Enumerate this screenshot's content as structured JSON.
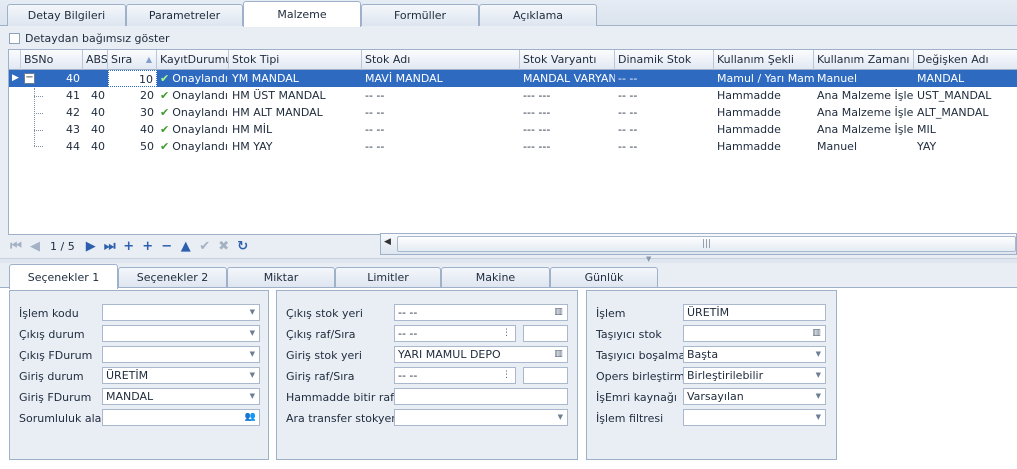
{
  "top_tabs": [
    "Detay Bilgileri",
    "Parametreler",
    "Malzeme",
    "Formüller",
    "Açıklama"
  ],
  "top_tab_active": "Malzeme",
  "independent_checkbox_label": "Detaydan bağımsız göster",
  "grid": {
    "columns": [
      "BSNo",
      "ABSI",
      "Sıra",
      "KayıtDurumu",
      "Stok Tipi",
      "Stok Adı",
      "Stok Varyantı",
      "Dinamik Stok",
      "Kullanım Şekli",
      "Kullanım Zamanı",
      "Değişken Adı"
    ],
    "rows": [
      {
        "bsno": "40",
        "absi": "",
        "sira": "10",
        "durum": "Onaylandı",
        "stok_tipi": "YM MANDAL",
        "stok_adi": "MAVİ MANDAL",
        "varyant": "MANDAL VARYANTI",
        "dinamik": "-- --",
        "kullanim_sekli": "Mamul / Yarı Mamul",
        "kullanim_zamani": "Manuel",
        "degisken": "MANDAL"
      },
      {
        "bsno": "41",
        "absi": "40",
        "sira": "20",
        "durum": "Onaylandı",
        "stok_tipi": "HM ÜST MANDAL",
        "stok_adi": "-- --",
        "varyant": "--- ---",
        "dinamik": "-- --",
        "kullanim_sekli": "Hammadde",
        "kullanim_zamani": "Ana Malzeme İşlemi",
        "degisken": "UST_MANDAL"
      },
      {
        "bsno": "42",
        "absi": "40",
        "sira": "30",
        "durum": "Onaylandı",
        "stok_tipi": "HM ALT MANDAL",
        "stok_adi": "-- --",
        "varyant": "--- ---",
        "dinamik": "-- --",
        "kullanim_sekli": "Hammadde",
        "kullanim_zamani": "Ana Malzeme İşlemi",
        "degisken": "ALT_MANDAL"
      },
      {
        "bsno": "43",
        "absi": "40",
        "sira": "40",
        "durum": "Onaylandı",
        "stok_tipi": "HM MİL",
        "stok_adi": "-- --",
        "varyant": "--- ---",
        "dinamik": "-- --",
        "kullanim_sekli": "Hammadde",
        "kullanim_zamani": "Ana Malzeme İşlemi",
        "degisken": "MIL"
      },
      {
        "bsno": "44",
        "absi": "40",
        "sira": "50",
        "durum": "Onaylandı",
        "stok_tipi": "HM YAY",
        "stok_adi": "-- --",
        "varyant": "--- ---",
        "dinamik": "-- --",
        "kullanim_sekli": "Hammadde",
        "kullanim_zamani": "Manuel",
        "degisken": "YAY"
      }
    ]
  },
  "navigator": {
    "page": "1 / 5"
  },
  "bottom_tabs": [
    "Seçenekler 1",
    "Seçenekler 2",
    "Miktar",
    "Limitler",
    "Makine",
    "Günlük"
  ],
  "bottom_tab_active": "Seçenekler 1",
  "group1": {
    "labels": [
      "İşlem kodu",
      "Çıkış durum",
      "Çıkış FDurum",
      "Giriş durum",
      "Giriş FDurum",
      "Sorumluluk alanı"
    ],
    "values": [
      "",
      "",
      "",
      "ÜRETİM",
      "MANDAL",
      ""
    ]
  },
  "group2": {
    "labels": [
      "Çıkış stok yeri",
      "Çıkış raf/Sıra",
      "Giriş stok yeri",
      "Giriş raf/Sıra",
      "Hammadde bitir raflar",
      "Ara transfer stokyeri"
    ],
    "values": [
      "-- --",
      "-- --",
      "YARI MAMUL DEPO",
      "-- --",
      "",
      ""
    ]
  },
  "group3": {
    "labels": [
      "İşlem",
      "Taşıyıcı stok",
      "Taşıyıcı boşalma",
      "Opers birleştirme",
      "İşEmri kaynağı",
      "İşlem filtresi"
    ],
    "values": [
      "ÜRETİM",
      "",
      "Başta",
      "Birleştirilebilir",
      "Varsayılan",
      ""
    ]
  },
  "colors": {
    "selection": "#2e6ac0",
    "check": "#3f9a2e",
    "nav": "#2c5fae"
  }
}
